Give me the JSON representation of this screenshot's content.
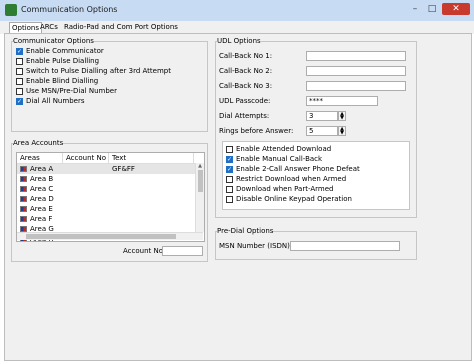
{
  "window": {
    "title": "Communication Options",
    "minimize": "–",
    "maximize": "□",
    "close": "✕"
  },
  "tabs": [
    {
      "label": "Options"
    },
    {
      "label": "ARCs"
    },
    {
      "label": "Radio-Pad and Com Port Options"
    }
  ],
  "communicator_options": {
    "title": "Communicator Options",
    "items": [
      {
        "label": "Enable Communicator",
        "checked": true
      },
      {
        "label": "Enable Pulse Dialling",
        "checked": false
      },
      {
        "label": "Switch to Pulse Dialling after 3rd Attempt",
        "checked": false
      },
      {
        "label": "Enable Blind Dialling",
        "checked": false
      },
      {
        "label": "Use MSN/Pre-Dial Number",
        "checked": false
      },
      {
        "label": "Dial All Numbers",
        "checked": true
      }
    ]
  },
  "area_accounts": {
    "title": "Area Accounts",
    "columns": [
      "Areas",
      "Account No",
      "Text"
    ],
    "rows": [
      {
        "area": "Area A",
        "account": "",
        "text": "GF&FF"
      },
      {
        "area": "Area B",
        "account": "",
        "text": ""
      },
      {
        "area": "Area C",
        "account": "",
        "text": ""
      },
      {
        "area": "Area D",
        "account": "",
        "text": ""
      },
      {
        "area": "Area E",
        "account": "",
        "text": ""
      },
      {
        "area": "Area F",
        "account": "",
        "text": ""
      },
      {
        "area": "Area G",
        "account": "",
        "text": ""
      },
      {
        "area": "Area H",
        "account": "",
        "text": ""
      }
    ],
    "account_no_label": "Account No:",
    "account_no_value": ""
  },
  "udl_options": {
    "title": "UDL Options",
    "callback1_label": "Call-Back No 1:",
    "callback1_value": "",
    "callback2_label": "Call-Back No 2:",
    "callback2_value": "",
    "callback3_label": "Call-Back No 3:",
    "callback3_value": "",
    "passcode_label": "UDL Passcode:",
    "passcode_value": "****",
    "attempts_label": "Dial Attempts:",
    "attempts_value": "3",
    "rings_label": "Rings before Answer:",
    "rings_value": "5",
    "checks": [
      {
        "label": "Enable Attended Download",
        "checked": false
      },
      {
        "label": "Enable Manual Call-Back",
        "checked": true
      },
      {
        "label": "Enable 2-Call Answer Phone Defeat",
        "checked": true
      },
      {
        "label": "Restrict Download when Armed",
        "checked": false
      },
      {
        "label": "Download when Part-Armed",
        "checked": false
      },
      {
        "label": "Disable Online Keypad Operation",
        "checked": false
      }
    ]
  },
  "pre_dial": {
    "title": "Pre-Dial Options",
    "msn_label": "MSN Number (ISDN):",
    "msn_value": ""
  }
}
